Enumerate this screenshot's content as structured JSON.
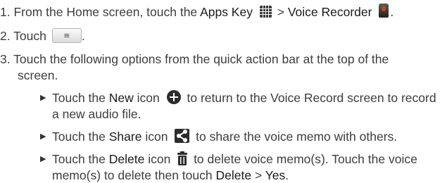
{
  "steps": {
    "s1": {
      "num": "1.",
      "text_a": "From the Home screen, touch the ",
      "apps_key": "Apps Key",
      "sep": " > ",
      "voice_recorder": "Voice Recorder",
      "end": "."
    },
    "s2": {
      "num": "2.",
      "text_a": "Touch",
      "end": "."
    },
    "s3": {
      "num": "3.",
      "line1": "Touch the following options from the quick action bar at the top of the",
      "line2": "screen."
    }
  },
  "bullets": {
    "b1": {
      "pre": "Touch the ",
      "bold": "New",
      "post_icon": "icon",
      "rest1": " to return to the Voice Record screen to record",
      "line2": "a new audio file."
    },
    "b2": {
      "pre": "Touch the ",
      "bold": "Share",
      "post_icon": "icon",
      "rest1": " to share the voice memo with others."
    },
    "b3": {
      "pre": "Touch the ",
      "bold": "Delete",
      "post_icon": "icon",
      "rest1": " to delete voice memo(s). Touch the voice",
      "line2_a": "memo(s) to delete then touch ",
      "line2_b": "Delete",
      "line2_sep": " > ",
      "line2_c": "Yes",
      "line2_end": "."
    }
  },
  "icons": {
    "apps": "apps-grid-icon",
    "recorder": "voice-recorder-icon",
    "menu": "menu-key-icon",
    "new": "circle-plus-icon",
    "share": "share-icon",
    "delete": "trash-icon",
    "bullet_glyph": "▶",
    "menu_glyph": "≡"
  }
}
